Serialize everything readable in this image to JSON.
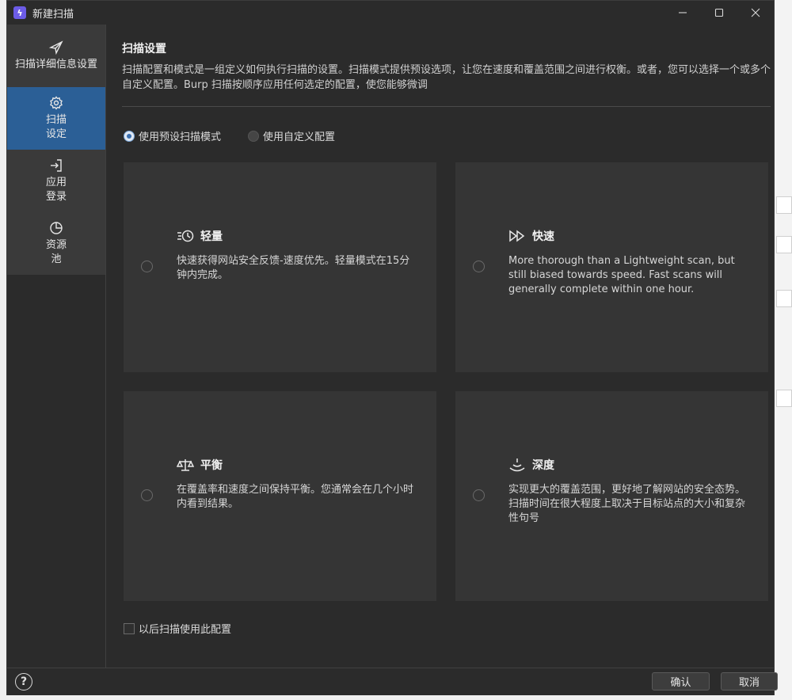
{
  "window": {
    "title": "新建扫描"
  },
  "sidebar": {
    "items": [
      {
        "label": "扫描详细信息设置",
        "icon": "send-icon",
        "active": false
      },
      {
        "label": "扫描\n设定",
        "icon": "gear-icon",
        "active": true
      },
      {
        "label": "应用\n登录",
        "icon": "login-icon",
        "active": false
      },
      {
        "label": "资源\n池",
        "icon": "pie-chart-icon",
        "active": false
      }
    ]
  },
  "main": {
    "title": "扫描设置",
    "description": "扫描配置和模式是一组定义如何执行扫描的设置。扫描模式提供预设选项，让您在速度和覆盖范围之间进行权衡。或者，您可以选择一个或多个自定义配置。Burp 扫描按顺序应用任何选定的配置，使您能够微调",
    "mode_options": [
      {
        "label": "使用预设扫描模式",
        "checked": true
      },
      {
        "label": "使用自定义配置",
        "checked": false
      }
    ],
    "cards": [
      {
        "title": "轻量",
        "icon": "lightweight-clock-icon",
        "text": "快速获得网站安全反馈-速度优先。轻量模式在15分钟内完成。"
      },
      {
        "title": "快速",
        "icon": "fast-forward-icon",
        "text": "More thorough than a Lightweight scan, but still biased towards speed. Fast scans will generally complete within one hour."
      },
      {
        "title": "平衡",
        "icon": "scale-icon",
        "text": "在覆盖率和速度之间保持平衡。您通常会在几个小时内看到结果。"
      },
      {
        "title": "深度",
        "icon": "deep-signal-icon",
        "text": "实现更大的覆盖范围，更好地了解网站的安全态势。扫描时间在很大程度上取决于目标站点的大小和复杂性句号"
      }
    ],
    "remember_checkbox": {
      "label": "以后扫描使用此配置",
      "checked": false
    }
  },
  "footer": {
    "help_label": "?",
    "ok_label": "确认",
    "cancel_label": "取消"
  },
  "colors": {
    "window_bg": "#2b2b2b",
    "sidebar_bg": "#3a3a3a",
    "active_item": "#2b5f96",
    "card_bg": "#353535"
  }
}
